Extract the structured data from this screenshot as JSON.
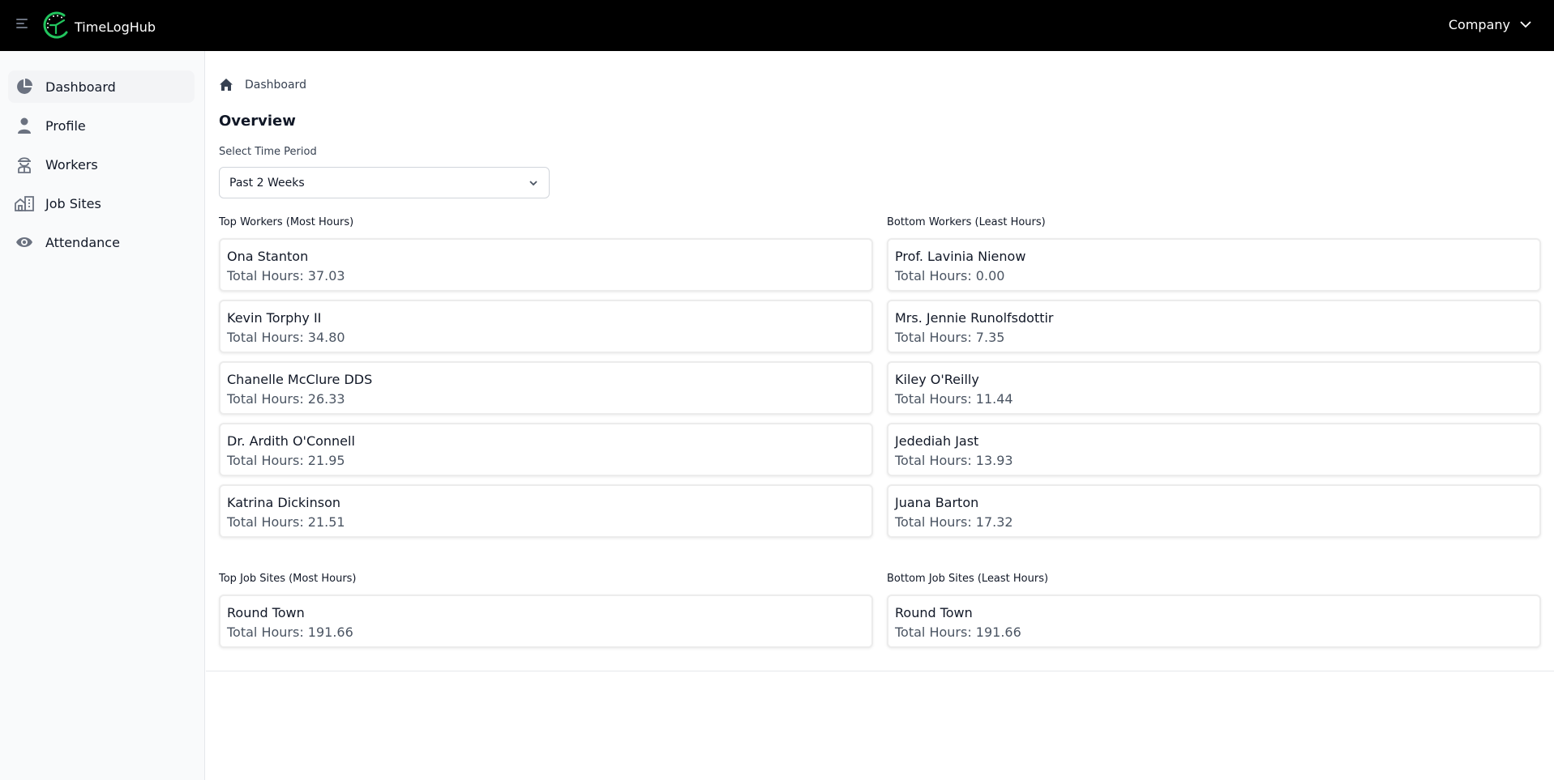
{
  "app": {
    "title": "TimeLogHub",
    "company_menu": "Company",
    "accent_color": "#22c55e"
  },
  "sidebar": {
    "items": [
      {
        "label": "Dashboard",
        "icon": "pie-chart-icon",
        "active": true
      },
      {
        "label": "Profile",
        "icon": "user-icon",
        "active": false
      },
      {
        "label": "Workers",
        "icon": "worker-icon",
        "active": false
      },
      {
        "label": "Job Sites",
        "icon": "building-icon",
        "active": false
      },
      {
        "label": "Attendance",
        "icon": "eye-icon",
        "active": false
      }
    ]
  },
  "breadcrumb": {
    "home_icon": "home-icon",
    "items": [
      "Dashboard"
    ]
  },
  "overview": {
    "title": "Overview",
    "time_period": {
      "label": "Select Time Period",
      "selected": "Past 2 Weeks"
    },
    "top_workers": {
      "label": "Top Workers (Most Hours)",
      "items": [
        {
          "name": "Ona Stanton",
          "hours": "Total Hours: 37.03"
        },
        {
          "name": "Kevin Torphy II",
          "hours": "Total Hours: 34.80"
        },
        {
          "name": "Chanelle McClure DDS",
          "hours": "Total Hours: 26.33"
        },
        {
          "name": "Dr. Ardith O'Connell",
          "hours": "Total Hours: 21.95"
        },
        {
          "name": "Katrina Dickinson",
          "hours": "Total Hours: 21.51"
        }
      ]
    },
    "bottom_workers": {
      "label": "Bottom Workers (Least Hours)",
      "items": [
        {
          "name": "Prof. Lavinia Nienow",
          "hours": "Total Hours: 0.00"
        },
        {
          "name": "Mrs. Jennie Runolfsdottir",
          "hours": "Total Hours: 7.35"
        },
        {
          "name": "Kiley O'Reilly",
          "hours": "Total Hours: 11.44"
        },
        {
          "name": "Jedediah Jast",
          "hours": "Total Hours: 13.93"
        },
        {
          "name": "Juana Barton",
          "hours": "Total Hours: 17.32"
        }
      ]
    },
    "top_job_sites": {
      "label": "Top Job Sites (Most Hours)",
      "items": [
        {
          "name": "Round Town",
          "hours": "Total Hours: 191.66"
        }
      ]
    },
    "bottom_job_sites": {
      "label": "Bottom Job Sites (Least Hours)",
      "items": [
        {
          "name": "Round Town",
          "hours": "Total Hours: 191.66"
        }
      ]
    }
  }
}
